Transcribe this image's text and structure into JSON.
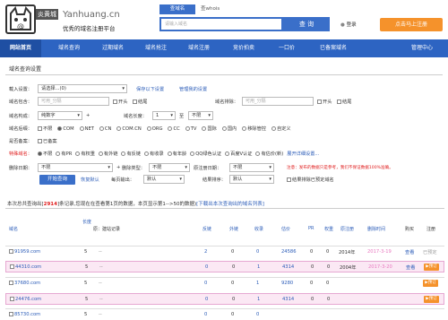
{
  "header": {
    "logo_chinese": "炎黄城",
    "logo_domain": "Yanhuang.cn",
    "logo_slogan": "优秀的域名注册平台",
    "search_tab_domain": "查域名",
    "search_tab_whois": "查whois",
    "search_placeholder": "请输入域名",
    "search_button": "查 询",
    "login_link": "登录",
    "register_button": "点击马上注册"
  },
  "nav": {
    "items": [
      "网站首页",
      "域名查询",
      "过期域名",
      "域名抢注",
      "域名注册",
      "竞价拍卖",
      "一口价",
      "已备案域名",
      "管理中心"
    ]
  },
  "breadcrumb": "域名查询设置",
  "filters": {
    "load_settings_label": "载入设置：",
    "load_settings_value": "请选择...(0)",
    "save_settings_link": "保存以下设置",
    "manage_settings_link": "管理我的设置",
    "domain_contains_label": "域名包含：",
    "domain_contains_placeholder": "可用_分隔",
    "head_label": "开头",
    "tail_label": "结尾",
    "domain_exclude_label": "域名排除：",
    "domain_exclude_placeholder": "可用_分隔",
    "composition_label": "域名构成：",
    "composition_value": "纯数字",
    "length_label": "域名长度：",
    "length_from": "1",
    "length_to_label": "至",
    "length_to": "不限",
    "suffix_label": "域名后缀：",
    "suffixes": [
      "不限",
      "COM",
      "NET",
      "CN",
      "COM.CN",
      "ORG",
      "CC",
      "TV",
      "国际",
      "国内",
      "移除管控",
      "自定义"
    ],
    "registered_label": "是否备案：",
    "registered_option": "已备案",
    "special_label": "特殊域名：",
    "special_options": [
      "不限",
      "有PR",
      "有权重",
      "有外链",
      "有反链",
      "有收录",
      "有年龄",
      "QQ绿色认证",
      "百度V认证",
      "有估价(新)"
    ],
    "expand_more_link": "展开详细设置...",
    "delete_date_label": "删除日期：",
    "delete_date_value": "不限",
    "drop_type_label": "删除类型：",
    "drop_type_value": "不限",
    "original_reg_label": "原注册日期：",
    "original_reg_value": "不限",
    "notice": "注意：发布的数据只是参考，我们不保证数据100%准确。",
    "query_button": "开始查询",
    "restore_default_link": "恢复默认",
    "per_page_label": "每页输出：",
    "per_page_value": "默认",
    "sort_label": "结果排序：",
    "sort_value": "默认",
    "hide_locked_label": "结果排除已预定域名"
  },
  "summary": {
    "prefix": "本次总共查询出[",
    "count": "2914",
    "suffix": "]条记录,您现在在查看第1页的数据，本页显示第1-->50的数据)",
    "download_link": "[下载出本次查询出的域名列表]"
  },
  "table": {
    "headers": {
      "domain": "域名",
      "length": "长度",
      "record": "原：建站记录",
      "backlinks": "反链",
      "outlinks": "外链",
      "indexed": "收录",
      "valuation": "估价",
      "pr": "PR",
      "weight": "权重",
      "reg_date": "原注册",
      "delete_date": "删除时间",
      "buy": "购买",
      "status": "注册"
    },
    "rows": [
      {
        "domain": "91959.com",
        "length": "5",
        "record": "--",
        "backlinks": "2",
        "outlinks": "0",
        "indexed": "0",
        "valuation": "24586",
        "pr": "0",
        "weight": "0",
        "reg_year": "2014年",
        "delete_date": "2017-3-19",
        "buy": "查看",
        "status": "已预定",
        "badge": false,
        "highlight": false
      },
      {
        "domain": "44310.com",
        "length": "5",
        "record": "--",
        "backlinks": "0",
        "outlinks": "0",
        "indexed": "1",
        "valuation": "4314",
        "pr": "0",
        "weight": "0",
        "reg_year": "2004年",
        "delete_date": "2017-3-20",
        "buy": "查看",
        "status": "预订",
        "badge": true,
        "highlight": true
      },
      {
        "domain": "37680.com",
        "length": "5",
        "record": "--",
        "backlinks": "0",
        "outlinks": "0",
        "indexed": "1",
        "valuation": "9280",
        "pr": "0",
        "weight": "0",
        "reg_year": "",
        "delete_date": "",
        "buy": "",
        "status": "预订",
        "badge": true,
        "highlight": false
      },
      {
        "domain": "24476.com",
        "length": "5",
        "record": "--",
        "backlinks": "0",
        "outlinks": "0",
        "indexed": "1",
        "valuation": "4314",
        "pr": "0",
        "weight": "0",
        "reg_year": "",
        "delete_date": "",
        "buy": "",
        "status": "预订",
        "badge": true,
        "highlight": true
      },
      {
        "domain": "85730.com",
        "length": "5",
        "record": "--",
        "backlinks": "0",
        "outlinks": "0",
        "indexed": "0",
        "valuation": "",
        "pr": "",
        "weight": "",
        "reg_year": "",
        "delete_date": "",
        "buy": "",
        "status": "",
        "badge": false,
        "highlight": false
      }
    ]
  },
  "colors": {
    "nav_bg": "#2d64c2",
    "accent_orange": "#f5922b",
    "link_blue": "#2b5cb8",
    "alert_red": "#e02020",
    "row_highlight": "#fbe8f4"
  }
}
